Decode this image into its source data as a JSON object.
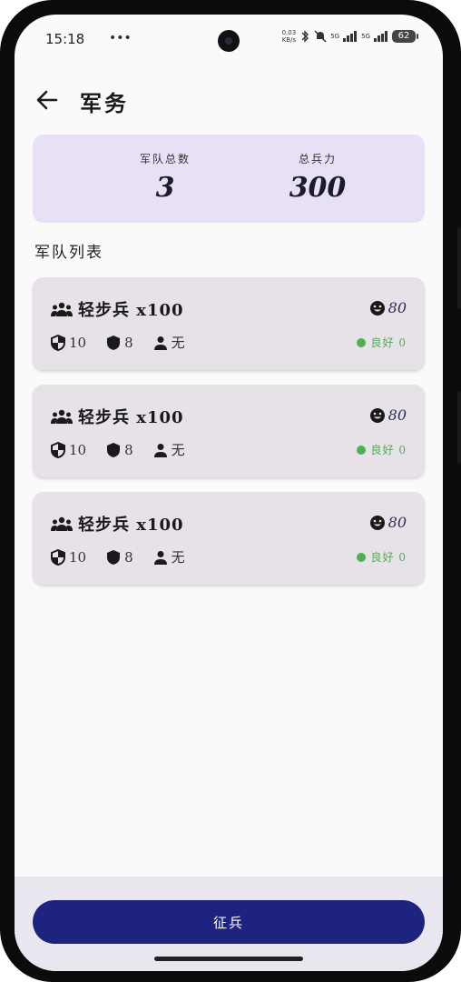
{
  "status_bar": {
    "time": "15:18",
    "more": "•••",
    "speed_top": "0.03",
    "speed_bottom": "KB/s",
    "net1": "5G",
    "net2": "5G",
    "battery": "62"
  },
  "header": {
    "title": "军务"
  },
  "summary": {
    "total_armies_label": "军队总数",
    "total_armies": "3",
    "total_troops_label": "总兵力",
    "total_troops": "300"
  },
  "list_title": "军队列表",
  "armies": [
    {
      "name": "轻步兵 x100",
      "morale": "80",
      "defense": "10",
      "armor": "8",
      "commander": "无",
      "status": "良好 0"
    },
    {
      "name": "轻步兵 x100",
      "morale": "80",
      "defense": "10",
      "armor": "8",
      "commander": "无",
      "status": "良好 0"
    },
    {
      "name": "轻步兵 x100",
      "morale": "80",
      "defense": "10",
      "armor": "8",
      "commander": "无",
      "status": "良好 0"
    }
  ],
  "footer": {
    "recruit_label": "征兵"
  },
  "colors": {
    "summary_bg": "#e8e0f6",
    "card_bg": "#e6e2e8",
    "primary": "#1e2380",
    "status_green": "#4caf50"
  }
}
